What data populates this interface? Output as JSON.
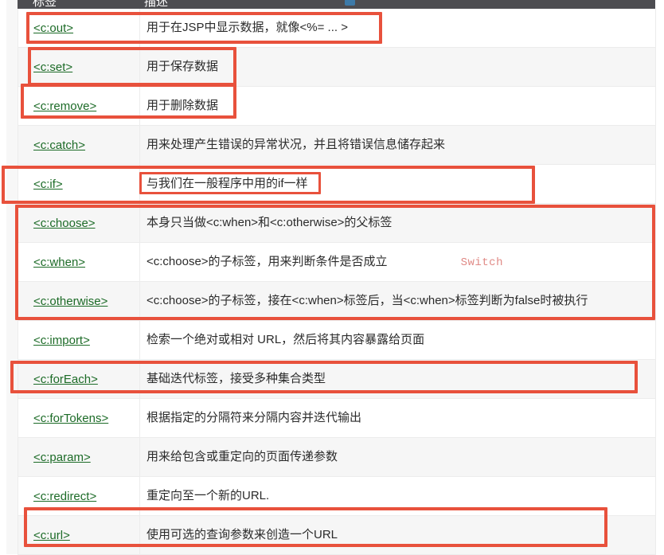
{
  "table": {
    "columns": [
      "标签",
      "描述"
    ],
    "rows": [
      {
        "tag": "<c:out>",
        "desc": "用于在JSP中显示数据，就像<%= ... >"
      },
      {
        "tag": "<c:set>",
        "desc": "用于保存数据"
      },
      {
        "tag": "<c:remove>",
        "desc": "用于删除数据"
      },
      {
        "tag": "<c:catch>",
        "desc": "用来处理产生错误的异常状况，并且将错误信息储存起来"
      },
      {
        "tag": "<c:if>",
        "desc": "与我们在一般程序中用的if一样"
      },
      {
        "tag": "<c:choose>",
        "desc": "本身只当做<c:when>和<c:otherwise>的父标签"
      },
      {
        "tag": "<c:when>",
        "desc": "<c:choose>的子标签，用来判断条件是否成立",
        "note": "Switch"
      },
      {
        "tag": "<c:otherwise>",
        "desc": "<c:choose>的子标签，接在<c:when>标签后，当<c:when>标签判断为false时被执行"
      },
      {
        "tag": "<c:import>",
        "desc": "检索一个绝对或相对 URL，然后将其内容暴露给页面"
      },
      {
        "tag": "<c:forEach>",
        "desc": "基础迭代标签，接受多种集合类型"
      },
      {
        "tag": "<c:forTokens>",
        "desc": "根据指定的分隔符来分隔内容并迭代输出"
      },
      {
        "tag": "<c:param>",
        "desc": "用来给包含或重定向的页面传递参数"
      },
      {
        "tag": "<c:redirect>",
        "desc": "重定向至一个新的URL."
      },
      {
        "tag": "<c:url>",
        "desc": "使用可选的查询参数来创造一个URL"
      }
    ]
  },
  "colors": {
    "annotation": "#e8513c",
    "link": "#1c6b27",
    "header_bg": "#4d4d51",
    "note": "#e08a86",
    "row_alt_bg": "#f6f6f6"
  }
}
